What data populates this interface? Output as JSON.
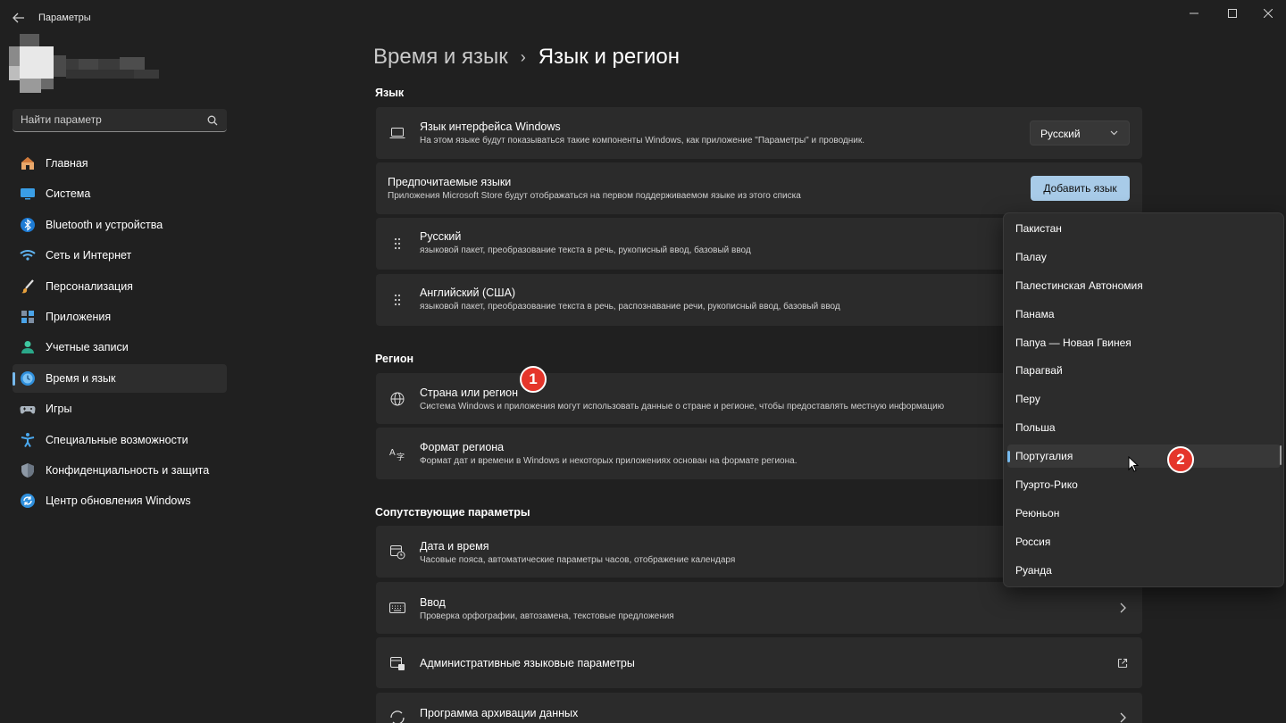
{
  "window": {
    "title": "Параметры"
  },
  "search": {
    "placeholder": "Найти параметр"
  },
  "sidebar": {
    "items": [
      {
        "label": "Главная",
        "icon": "home-icon"
      },
      {
        "label": "Система",
        "icon": "system-icon"
      },
      {
        "label": "Bluetooth и устройства",
        "icon": "bluetooth-icon"
      },
      {
        "label": "Сеть и Интернет",
        "icon": "wifi-icon"
      },
      {
        "label": "Персонализация",
        "icon": "brush-icon"
      },
      {
        "label": "Приложения",
        "icon": "apps-icon"
      },
      {
        "label": "Учетные записи",
        "icon": "account-icon"
      },
      {
        "label": "Время и язык",
        "icon": "time-language-icon",
        "active": true
      },
      {
        "label": "Игры",
        "icon": "gamepad-icon"
      },
      {
        "label": "Специальные возможности",
        "icon": "accessibility-icon"
      },
      {
        "label": "Конфиденциальность и защита",
        "icon": "shield-icon"
      },
      {
        "label": "Центр обновления Windows",
        "icon": "update-icon"
      }
    ]
  },
  "breadcrumb": {
    "parent": "Время и язык",
    "separator": "›",
    "current": "Язык и регион"
  },
  "language": {
    "section_title": "Язык",
    "display_language": {
      "title": "Язык интерфейса Windows",
      "desc": "На этом языке будут показываться такие компоненты Windows, как приложение \"Параметры\" и проводник.",
      "value": "Русский"
    },
    "preferred": {
      "title": "Предпочитаемые языки",
      "desc": "Приложения Microsoft Store будут отображаться на первом поддерживаемом языке из этого списка",
      "button": "Добавить язык"
    },
    "items": [
      {
        "title": "Русский",
        "desc": "языковой пакет, преобразование текста в речь, рукописный ввод, базовый ввод"
      },
      {
        "title": "Английский (США)",
        "desc": "языковой пакет, преобразование текста в речь, распознавание речи, рукописный ввод, базовый ввод"
      }
    ]
  },
  "region": {
    "section_title": "Регион",
    "country": {
      "title": "Страна или регион",
      "desc": "Система Windows и приложения могут использовать данные о стране и регионе, чтобы предоставлять местную информацию"
    },
    "format": {
      "title": "Формат региона",
      "desc": "Формат дат и времени в Windows и некоторых приложениях основан на формате региона."
    }
  },
  "related": {
    "section_title": "Сопутствующие параметры",
    "items": [
      {
        "title": "Дата и время",
        "desc": "Часовые пояса, автоматические параметры часов, отображение календаря"
      },
      {
        "title": "Ввод",
        "desc": "Проверка орфографии, автозамена, текстовые предложения"
      },
      {
        "title": "Административные языковые параметры",
        "desc": ""
      },
      {
        "title": "Программа архивации данных",
        "desc": ""
      }
    ]
  },
  "country_popup": {
    "items": [
      "Пакистан",
      "Палау",
      "Палестинская Автономия",
      "Панама",
      "Папуа — Новая Гвинея",
      "Парагвай",
      "Перу",
      "Польша",
      "Португалия",
      "Пуэрто-Рико",
      "Реюньон",
      "Россия",
      "Руанда"
    ],
    "selected": "Португалия"
  },
  "annotations": {
    "badge1": "1",
    "badge2": "2"
  },
  "colors": {
    "background": "#202020",
    "card": "#2b2b2b",
    "accent": "#76b9ed",
    "accent_button": "#a8cbe8",
    "badge": "#e5352b"
  }
}
